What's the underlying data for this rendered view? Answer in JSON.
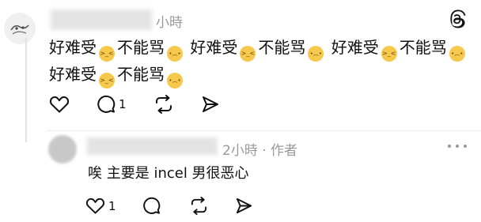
{
  "post": {
    "time": "小時",
    "segments": [
      {
        "t": "text",
        "v": "好难受"
      },
      {
        "t": "emoji",
        "name": "tired-face-emoji"
      },
      {
        "t": "text",
        "v": "不能骂"
      },
      {
        "t": "emoji",
        "name": "frowning-face-emoji"
      },
      {
        "t": "text",
        "v": " 好难受"
      },
      {
        "t": "emoji",
        "name": "tired-face-emoji"
      },
      {
        "t": "text",
        "v": "不能骂"
      },
      {
        "t": "emoji",
        "name": "frowning-face-emoji"
      },
      {
        "t": "text",
        "v": " 好难受"
      },
      {
        "t": "emoji",
        "name": "tired-face-emoji"
      },
      {
        "t": "text",
        "v": "不能骂"
      },
      {
        "t": "emoji",
        "name": "frowning-face-emoji"
      },
      {
        "t": "text",
        "v": " 好难受"
      },
      {
        "t": "emoji",
        "name": "tired-face-emoji"
      },
      {
        "t": "text",
        "v": "不能骂"
      },
      {
        "t": "emoji",
        "name": "frowning-face-emoji"
      }
    ],
    "actions": {
      "reply_count": "1"
    }
  },
  "reply": {
    "meta": "2小時 · 作者",
    "text": "唉 主要是 incel 男很恶心",
    "actions": {
      "like_count": "1"
    }
  },
  "icons": {
    "logo": "threads-logo-icon",
    "like": "heart-icon",
    "comment": "comment-icon",
    "repost": "repost-icon",
    "share": "share-icon",
    "more": "more-icon"
  }
}
